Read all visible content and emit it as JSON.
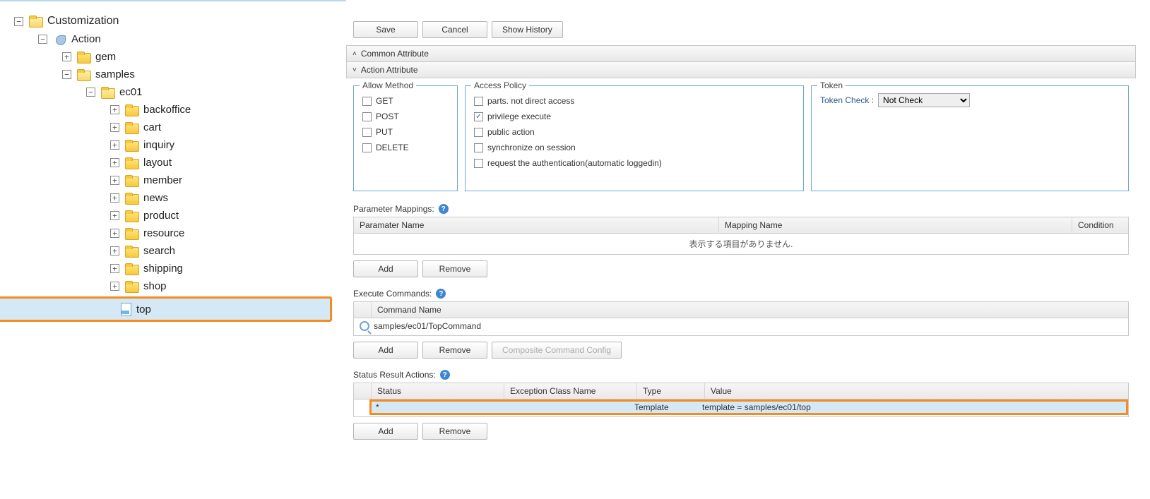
{
  "tree": {
    "root": "Customization",
    "action": "Action",
    "gem": "gem",
    "samples": "samples",
    "ec01": "ec01",
    "items": {
      "backoffice": "backoffice",
      "cart": "cart",
      "inquiry": "inquiry",
      "layout": "layout",
      "member": "member",
      "news": "news",
      "product": "product",
      "resource": "resource",
      "search": "search",
      "shipping": "shipping",
      "shop": "shop"
    },
    "top": "top"
  },
  "toolbar": {
    "save": "Save",
    "cancel": "Cancel",
    "history": "Show History"
  },
  "sections": {
    "common": "Common Attribute",
    "action": "Action Attribute"
  },
  "allow": {
    "legend": "Allow Method",
    "get": "GET",
    "post": "POST",
    "put": "PUT",
    "delete": "DELETE"
  },
  "access": {
    "legend": "Access Policy",
    "parts": "parts. not direct access",
    "priv": "privilege execute",
    "public": "public action",
    "sync": "synchronize on session",
    "auth": "request the authentication(automatic loggedin)"
  },
  "token": {
    "legend": "Token",
    "label": "Token Check :",
    "value": "Not Check"
  },
  "param": {
    "title": "Parameter Mappings:",
    "col1": "Paramater Name",
    "col2": "Mapping Name",
    "col3": "Condition",
    "empty": "表示する項目がありません."
  },
  "btns": {
    "add": "Add",
    "remove": "Remove",
    "composite": "Composite Command Config"
  },
  "exec": {
    "title": "Execute Commands:",
    "col1": "Command Name",
    "row1": "samples/ec01/TopCommand"
  },
  "status": {
    "title": "Status Result Actions:",
    "col1": "Status",
    "col2": "Exception Class Name",
    "col3": "Type",
    "col4": "Value",
    "r_status": "*",
    "r_type": "Template",
    "r_value": "template = samples/ec01/top"
  }
}
